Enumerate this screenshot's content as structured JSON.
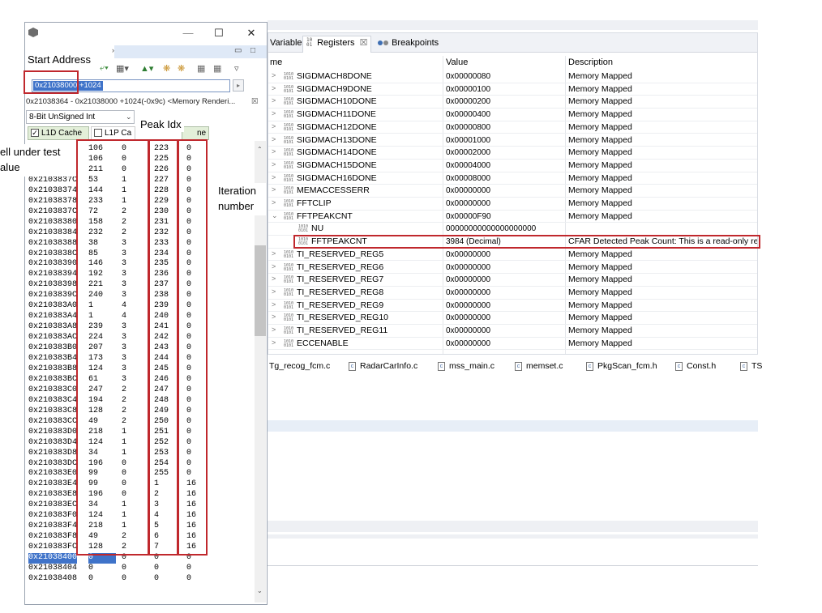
{
  "registers_view": {
    "tabs": [
      {
        "label": "Variables",
        "icon": "variables-icon"
      },
      {
        "label": "Registers",
        "icon": "registers-icon",
        "close": "☒"
      },
      {
        "label": "Breakpoints",
        "icon": "breakpoints-icon"
      }
    ],
    "columns": {
      "name": "me",
      "value": "Value",
      "description": "Description"
    },
    "rows": [
      {
        "name": "SIGDMACH8DONE",
        "value": "0x00000080",
        "description": "Memory Mapped",
        "expand": ">"
      },
      {
        "name": "SIGDMACH9DONE",
        "value": "0x00000100",
        "description": "Memory Mapped",
        "expand": ">"
      },
      {
        "name": "SIGDMACH10DONE",
        "value": "0x00000200",
        "description": "Memory Mapped",
        "expand": ">"
      },
      {
        "name": "SIGDMACH11DONE",
        "value": "0x00000400",
        "description": "Memory Mapped",
        "expand": ">"
      },
      {
        "name": "SIGDMACH12DONE",
        "value": "0x00000800",
        "description": "Memory Mapped",
        "expand": ">"
      },
      {
        "name": "SIGDMACH13DONE",
        "value": "0x00001000",
        "description": "Memory Mapped",
        "expand": ">"
      },
      {
        "name": "SIGDMACH14DONE",
        "value": "0x00002000",
        "description": "Memory Mapped",
        "expand": ">"
      },
      {
        "name": "SIGDMACH15DONE",
        "value": "0x00004000",
        "description": "Memory Mapped",
        "expand": ">"
      },
      {
        "name": "SIGDMACH16DONE",
        "value": "0x00008000",
        "description": "Memory Mapped",
        "expand": ">"
      },
      {
        "name": "MEMACCESSERR",
        "value": "0x00000000",
        "description": "Memory Mapped",
        "expand": ">"
      },
      {
        "name": "FFTCLIP",
        "value": "0x00000000",
        "description": "Memory Mapped",
        "expand": ">"
      },
      {
        "name": "FFTPEAKCNT",
        "value": "0x00000F90",
        "description": "Memory Mapped",
        "expand": "⌄"
      },
      {
        "name": "NU",
        "value": "00000000000000000000",
        "description": "",
        "expand": "",
        "child": true
      },
      {
        "name": "FFTPEAKCNT",
        "value": "3984 (Decimal)",
        "description": "CFAR Detected Peak Count: This is a read-only regis",
        "expand": "",
        "child": true
      },
      {
        "name": "TI_RESERVED_REG5",
        "value": "0x00000000",
        "description": "Memory Mapped",
        "expand": ">"
      },
      {
        "name": "TI_RESERVED_REG6",
        "value": "0x00000000",
        "description": "Memory Mapped",
        "expand": ">"
      },
      {
        "name": "TI_RESERVED_REG7",
        "value": "0x00000000",
        "description": "Memory Mapped",
        "expand": ">"
      },
      {
        "name": "TI_RESERVED_REG8",
        "value": "0x00000000",
        "description": "Memory Mapped",
        "expand": ">"
      },
      {
        "name": "TI_RESERVED_REG9",
        "value": "0x00000000",
        "description": "Memory Mapped",
        "expand": ">"
      },
      {
        "name": "TI_RESERVED_REG10",
        "value": "0x00000000",
        "description": "Memory Mapped",
        "expand": ">"
      },
      {
        "name": "TI_RESERVED_REG11",
        "value": "0x00000000",
        "description": "Memory Mapped",
        "expand": ">"
      },
      {
        "name": "ECCENABLE",
        "value": "0x00000000",
        "description": "Memory Mapped",
        "expand": ">"
      }
    ],
    "register_icon": "1010\n0101"
  },
  "file_tabs": [
    {
      "label": "Tg_recog_fcm.c",
      "icon": ""
    },
    {
      "label": "RadarCarInfo.c",
      "icon": "c"
    },
    {
      "label": "mss_main.c",
      "icon": "c"
    },
    {
      "label": "memset.c",
      "icon": "c"
    },
    {
      "label": "PkgScan_fcm.h",
      "icon": "c"
    },
    {
      "label": "Const.h",
      "icon": "c"
    },
    {
      "label": "TS",
      "icon": "c"
    }
  ],
  "memory_window": {
    "window_buttons": {
      "minimize": "—",
      "maximize": "☐",
      "close": "✕"
    },
    "address_expression": "0x21038000 +1024",
    "rendering_line": "0x21038364 - 0x21038000 +1024(-0x9c) <Memory Renderi...",
    "rendering_close": "☒",
    "format": "8-Bit UnSigned Int",
    "caches": [
      {
        "label": "L1D Cache",
        "checked": true
      },
      {
        "label": "L1P Ca",
        "checked": false
      }
    ],
    "rows": [
      {
        "addr": "",
        "c": [
          "106",
          "0",
          "223",
          "0"
        ]
      },
      {
        "addr": "",
        "c": [
          "106",
          "0",
          "225",
          "0"
        ]
      },
      {
        "addr": "",
        "c": [
          "211",
          "0",
          "226",
          "0"
        ]
      },
      {
        "addr": "0x2103837C",
        "c": [
          "53",
          "1",
          "227",
          "0"
        ]
      },
      {
        "addr": "0x21038374",
        "c": [
          "144",
          "1",
          "228",
          "0"
        ]
      },
      {
        "addr": "0x21038378",
        "c": [
          "233",
          "1",
          "229",
          "0"
        ]
      },
      {
        "addr": "0x2103837C",
        "c": [
          "72",
          "2",
          "230",
          "0"
        ]
      },
      {
        "addr": "0x21038380",
        "c": [
          "158",
          "2",
          "231",
          "0"
        ]
      },
      {
        "addr": "0x21038384",
        "c": [
          "232",
          "2",
          "232",
          "0"
        ]
      },
      {
        "addr": "0x21038388",
        "c": [
          "38",
          "3",
          "233",
          "0"
        ]
      },
      {
        "addr": "0x2103838C",
        "c": [
          "85",
          "3",
          "234",
          "0"
        ]
      },
      {
        "addr": "0x21038390",
        "c": [
          "146",
          "3",
          "235",
          "0"
        ]
      },
      {
        "addr": "0x21038394",
        "c": [
          "192",
          "3",
          "236",
          "0"
        ]
      },
      {
        "addr": "0x21038398",
        "c": [
          "221",
          "3",
          "237",
          "0"
        ]
      },
      {
        "addr": "0x2103839C",
        "c": [
          "240",
          "3",
          "238",
          "0"
        ]
      },
      {
        "addr": "0x210383A0",
        "c": [
          "1",
          "4",
          "239",
          "0"
        ]
      },
      {
        "addr": "0x210383A4",
        "c": [
          "1",
          "4",
          "240",
          "0"
        ]
      },
      {
        "addr": "0x210383A8",
        "c": [
          "239",
          "3",
          "241",
          "0"
        ]
      },
      {
        "addr": "0x210383AC",
        "c": [
          "224",
          "3",
          "242",
          "0"
        ]
      },
      {
        "addr": "0x210383B0",
        "c": [
          "207",
          "3",
          "243",
          "0"
        ]
      },
      {
        "addr": "0x210383B4",
        "c": [
          "173",
          "3",
          "244",
          "0"
        ]
      },
      {
        "addr": "0x210383B8",
        "c": [
          "124",
          "3",
          "245",
          "0"
        ]
      },
      {
        "addr": "0x210383BC",
        "c": [
          "61",
          "3",
          "246",
          "0"
        ]
      },
      {
        "addr": "0x210383C0",
        "c": [
          "247",
          "2",
          "247",
          "0"
        ]
      },
      {
        "addr": "0x210383C4",
        "c": [
          "194",
          "2",
          "248",
          "0"
        ]
      },
      {
        "addr": "0x210383C8",
        "c": [
          "128",
          "2",
          "249",
          "0"
        ]
      },
      {
        "addr": "0x210383CC",
        "c": [
          "49",
          "2",
          "250",
          "0"
        ]
      },
      {
        "addr": "0x210383D0",
        "c": [
          "218",
          "1",
          "251",
          "0"
        ]
      },
      {
        "addr": "0x210383D4",
        "c": [
          "124",
          "1",
          "252",
          "0"
        ]
      },
      {
        "addr": "0x210383D8",
        "c": [
          "34",
          "1",
          "253",
          "0"
        ]
      },
      {
        "addr": "0x210383DC",
        "c": [
          "196",
          "0",
          "254",
          "0"
        ]
      },
      {
        "addr": "0x210383E0",
        "c": [
          "99",
          "0",
          "255",
          "0"
        ]
      },
      {
        "addr": "0x210383E4",
        "c": [
          "99",
          "0",
          "1",
          "16"
        ]
      },
      {
        "addr": "0x210383E8",
        "c": [
          "196",
          "0",
          "2",
          "16"
        ]
      },
      {
        "addr": "0x210383EC",
        "c": [
          "34",
          "1",
          "3",
          "16"
        ]
      },
      {
        "addr": "0x210383F0",
        "c": [
          "124",
          "1",
          "4",
          "16"
        ]
      },
      {
        "addr": "0x210383F4",
        "c": [
          "218",
          "1",
          "5",
          "16"
        ]
      },
      {
        "addr": "0x210383F8",
        "c": [
          "49",
          "2",
          "6",
          "16"
        ]
      },
      {
        "addr": "0x210383FC",
        "c": [
          "128",
          "2",
          "7",
          "16"
        ]
      },
      {
        "addr": "0x21038400",
        "c": [
          "0",
          "0",
          "0",
          "0"
        ],
        "selected": true
      },
      {
        "addr": "0x21038404",
        "c": [
          "0",
          "0",
          "0",
          "0"
        ]
      },
      {
        "addr": "0x21038408",
        "c": [
          "0",
          "0",
          "0",
          "0"
        ]
      }
    ]
  },
  "annotations": {
    "start_address": "Start Address",
    "peak_idx": "Peak Idx",
    "cell_under_test": "ell under test",
    "cell_value": "alue",
    "iteration": "Iteration",
    "number": "number"
  },
  "colors": {
    "highlight": "#c0282d",
    "selection": "#3f73c9"
  }
}
